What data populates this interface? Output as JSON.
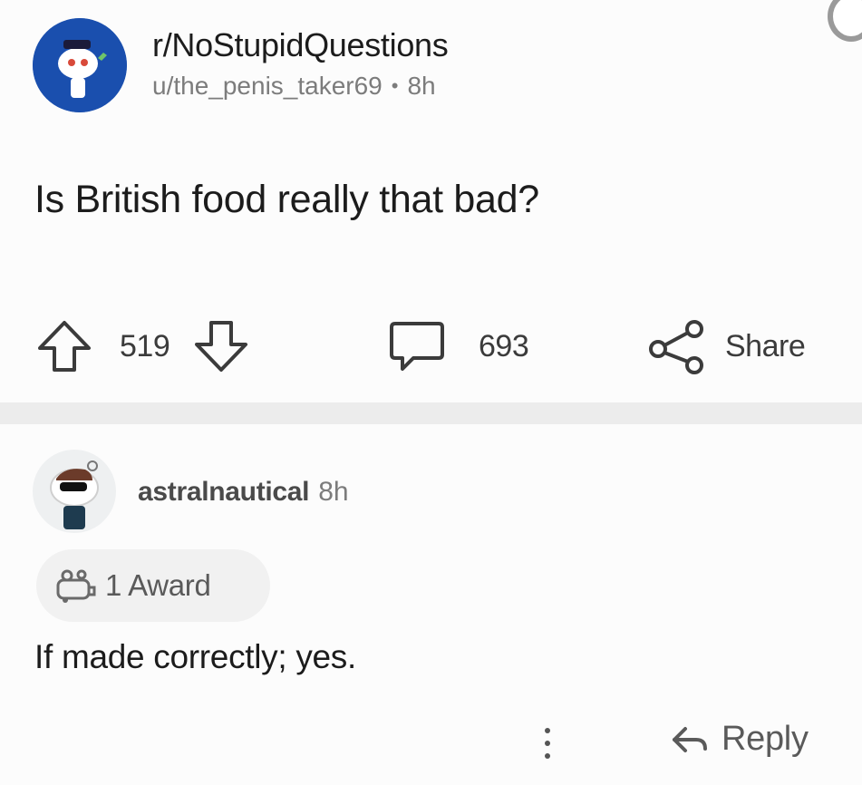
{
  "post": {
    "subreddit": "r/NoStupidQuestions",
    "author": "u/the_penis_taker69",
    "separator": "•",
    "age": "8h",
    "title": "Is British food really that bad?",
    "upvotes": "519",
    "comments": "693",
    "share_label": "Share"
  },
  "comment": {
    "username": "astralnautical",
    "age": "8h",
    "award_label": "1 Award",
    "body": "If made correctly; yes.",
    "reply_label": "Reply"
  },
  "icons": {
    "subreddit_avatar": "subreddit-avatar-icon",
    "upvote": "arrow-up-icon",
    "downvote": "arrow-down-icon",
    "comment": "speech-bubble-icon",
    "share": "share-icon",
    "award": "award-icon",
    "more": "vertical-dots-icon",
    "reply": "reply-arrow-icon"
  },
  "colors": {
    "subreddit_avatar_bg": "#1a4fae",
    "meta_text": "#7c7c7c",
    "divider": "#ececec"
  }
}
